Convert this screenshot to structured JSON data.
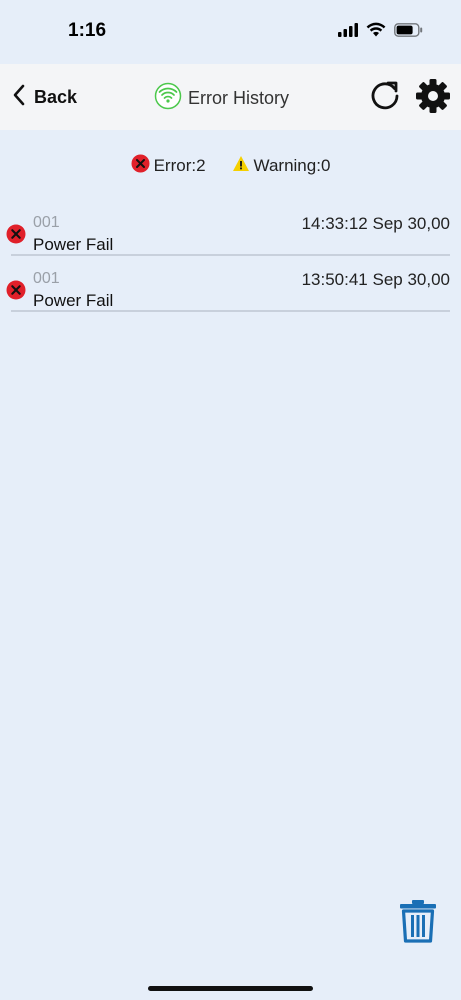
{
  "status_bar": {
    "time": "1:16"
  },
  "nav": {
    "back_label": "Back",
    "title": "Error History",
    "connection_icon": "wifi-icon",
    "connection_color": "#4cc84c",
    "refresh_icon": "refresh-icon",
    "settings_icon": "gear-icon"
  },
  "summary": {
    "error_label": "Error:2",
    "warning_label": "Warning:0"
  },
  "rows": [
    {
      "code": "001",
      "description": "Power Fail",
      "timestamp": "14:33:12 Sep 30,00",
      "severity": "error"
    },
    {
      "code": "001",
      "description": "Power Fail",
      "timestamp": "13:50:41 Sep 30,00",
      "severity": "error"
    }
  ],
  "colors": {
    "error": "#e0202a",
    "warning": "#f5d000",
    "accent": "#1a6fb5",
    "background": "#e6eef9"
  },
  "toolbar": {
    "delete_icon": "trash-icon"
  }
}
